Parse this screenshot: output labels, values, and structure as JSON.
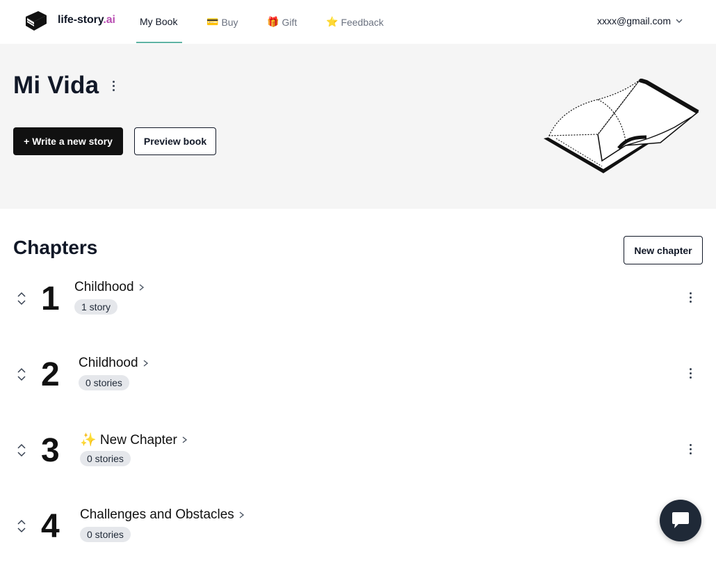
{
  "nav": {
    "brand_main": "life-story",
    "brand_suffix": ".ai",
    "items": [
      {
        "label": "My Book",
        "emoji": "",
        "active": true
      },
      {
        "label": "Buy",
        "emoji": "💳",
        "active": false
      },
      {
        "label": "Gift",
        "emoji": "🎁",
        "active": false
      },
      {
        "label": "Feedback",
        "emoji": "⭐",
        "active": false
      }
    ],
    "user_email": "xxxx@gmail.com",
    "accent_color": "#5eb3a3"
  },
  "hero": {
    "book_title": "Mi Vida",
    "write_story_label": "+ Write a new story",
    "preview_label": "Preview book",
    "illustration": "open-book-icon"
  },
  "chapters": {
    "title": "Chapters",
    "new_chapter_label": "New chapter",
    "items": [
      {
        "number": "1",
        "name": "Childhood",
        "count": "1 story"
      },
      {
        "number": "2",
        "name": "Childhood",
        "count": "0 stories"
      },
      {
        "number": "3",
        "name": "✨ New Chapter",
        "count": "0 stories"
      },
      {
        "number": "4",
        "name": "Challenges and Obstacles",
        "count": "0 stories"
      }
    ]
  },
  "chat": {
    "icon": "chat-bubble-icon"
  }
}
